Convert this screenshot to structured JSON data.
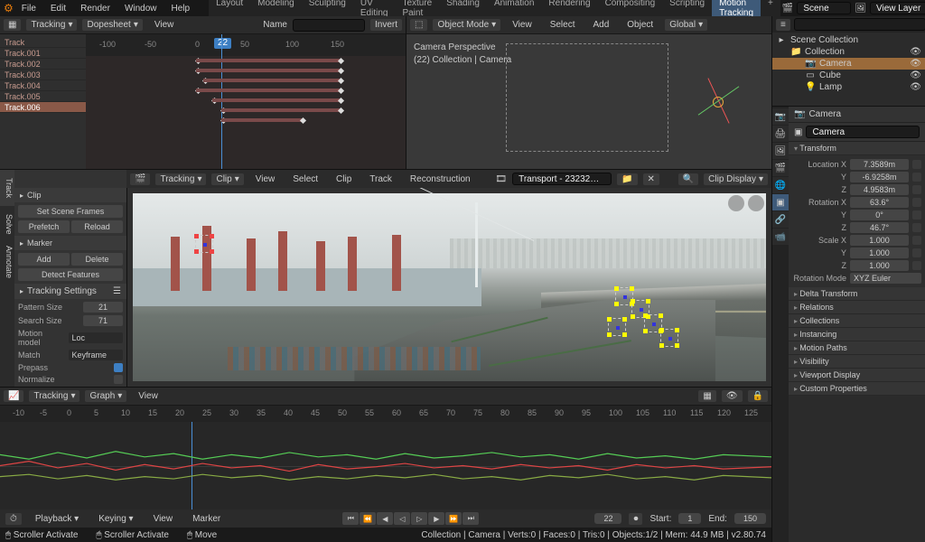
{
  "top_menu": [
    "File",
    "Edit",
    "Render",
    "Window",
    "Help"
  ],
  "workspaces": [
    "Layout",
    "Modeling",
    "Sculpting",
    "UV Editing",
    "Texture Paint",
    "Shading",
    "Animation",
    "Rendering",
    "Compositing",
    "Scripting",
    "Motion Tracking",
    "+"
  ],
  "active_workspace": "Motion Tracking",
  "scene": {
    "label": "Scene",
    "view_layer": "View Layer"
  },
  "dopesheet": {
    "mode_label": "Tracking",
    "type": "Dopesheet",
    "menu": [
      "View"
    ],
    "name_label": "Name",
    "invert": "Invert",
    "ruler": [
      "-100",
      "-50",
      "0",
      "50",
      "100",
      "150"
    ],
    "current": "22",
    "tracks": [
      "Track",
      "Track.001",
      "Track.002",
      "Track.003",
      "Track.004",
      "Track.005",
      "Track.006"
    ],
    "active_track": "Track.006"
  },
  "viewport3d": {
    "mode": "Object Mode",
    "menus": [
      "View",
      "Select",
      "Add",
      "Object"
    ],
    "orient": "Global",
    "overlay_line1": "Camera Perspective",
    "overlay_line2": "(22) Collection | Camera"
  },
  "clip": {
    "mode": "Tracking",
    "type": "Clip",
    "menus": [
      "View",
      "Select",
      "Clip",
      "Track",
      "Reconstruction"
    ],
    "clip_name": "Transport - 23232…",
    "display": "Clip Display",
    "sections": {
      "clip": "Clip",
      "set_scene": "Set Scene Frames",
      "prefetch": "Prefetch",
      "reload": "Reload",
      "marker": "Marker",
      "add": "Add",
      "delete": "Delete",
      "detect": "Detect Features",
      "tracking_settings": "Tracking Settings",
      "pattern_size": "Pattern Size",
      "pattern_val": "21",
      "search_size": "Search Size",
      "search_val": "71",
      "motion_model": "Motion model",
      "motion_val": "Loc",
      "match": "Match",
      "match_val": "Keyframe",
      "prepass": "Prepass",
      "normalize": "Normalize"
    },
    "side_tabs": [
      "Track",
      "Solve",
      "Annotate"
    ]
  },
  "graph": {
    "mode": "Tracking",
    "type": "Graph",
    "menus": [
      "View"
    ],
    "ticks": [
      "-10",
      "-5",
      "0",
      "5",
      "10",
      "15",
      "20",
      "25",
      "30",
      "35",
      "40",
      "45",
      "50",
      "55",
      "60",
      "65",
      "70",
      "75",
      "80",
      "85",
      "90",
      "95",
      "100",
      "105",
      "110",
      "115",
      "120",
      "125"
    ],
    "current": "22"
  },
  "timeline": {
    "playback": "Playback",
    "keying": "Keying",
    "view": "View",
    "marker": "Marker",
    "frame": "22",
    "start_lbl": "Start:",
    "start": "1",
    "end_lbl": "End:",
    "end": "150"
  },
  "status": {
    "left1": "Scroller Activate",
    "left2": "Scroller Activate",
    "left3": "Move",
    "right": "Collection | Camera | Verts:0 | Faces:0 | Tris:0 | Objects:1/2 | Mem: 44.9 MB | v2.80.74"
  },
  "outliner": {
    "title": "Scene Collection",
    "items": [
      {
        "name": "Collection",
        "icon": "📁",
        "depth": 1
      },
      {
        "name": "Camera",
        "icon": "📷",
        "depth": 2,
        "sel": true
      },
      {
        "name": "Cube",
        "icon": "▭",
        "depth": 2
      },
      {
        "name": "Lamp",
        "icon": "💡",
        "depth": 2
      }
    ]
  },
  "properties": {
    "breadcrumb": "Camera",
    "object_name": "Camera",
    "transform": {
      "title": "Transform",
      "loc": [
        "7.3589m",
        "-6.9258m",
        "4.9583m"
      ],
      "rot": [
        "63.6°",
        "0°",
        "46.7°"
      ],
      "scale": [
        "1.000",
        "1.000",
        "1.000"
      ],
      "labels": {
        "loc": "Location X",
        "rot": "Rotation X",
        "scale": "Scale X",
        "y": "Y",
        "z": "Z"
      },
      "rot_mode_lbl": "Rotation Mode",
      "rot_mode": "XYZ Euler"
    },
    "sections": [
      "Delta Transform",
      "Relations",
      "Collections",
      "Instancing",
      "Motion Paths",
      "Visibility",
      "Viewport Display",
      "Custom Properties"
    ]
  }
}
